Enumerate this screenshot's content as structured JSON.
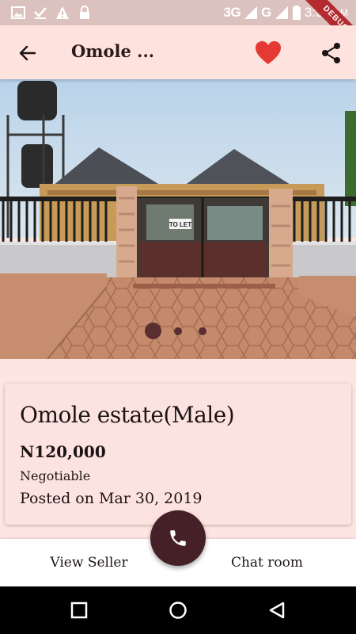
{
  "status_bar": {
    "network": "3G",
    "network2": "G",
    "time": "3:31",
    "ampm": "AM",
    "debug_label": "DEBUG"
  },
  "app_bar": {
    "title": "Omole ...",
    "back_icon": "arrow-left-icon",
    "favorite_icon": "heart-icon",
    "favorite_color": "#e53935",
    "share_icon": "share-icon"
  },
  "gallery": {
    "image_count": 3,
    "active_index": 0,
    "gate_sign": "TO LET"
  },
  "listing": {
    "title": "Omole estate(Male)",
    "price": "N120,000",
    "negotiable": "Negotiable",
    "posted": "Posted on Mar 30, 2019"
  },
  "bottom_bar": {
    "view_seller": "View Seller",
    "chat_room": "Chat room",
    "call_icon": "phone-icon",
    "fab_color": "#452026"
  },
  "nav": {
    "recents_icon": "square-icon",
    "home_icon": "circle-icon",
    "back_icon": "triangle-back-icon"
  },
  "colors": {
    "background": "#fde5e2",
    "app_bar": "#fde2de",
    "status_bar": "#dcc2bf",
    "dot": "#5a2e31"
  }
}
